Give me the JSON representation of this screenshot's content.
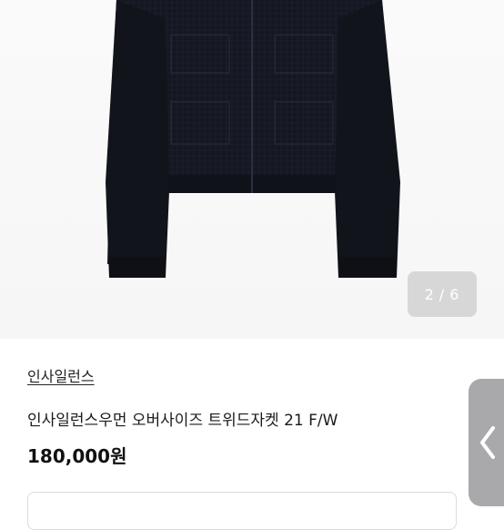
{
  "gallery": {
    "current": "2",
    "separator": "/",
    "total": "6"
  },
  "product": {
    "brand": "인사일런스",
    "title": "인사일런스우먼 오버사이즈 트위드자켓 21 F/W",
    "price": "180,000원"
  },
  "icons": {
    "side_tab": "chevron-left-icon"
  },
  "colors": {
    "jacket": "#14161e",
    "background": "#f7f7f7",
    "side_tab": "#a9a9ab"
  }
}
